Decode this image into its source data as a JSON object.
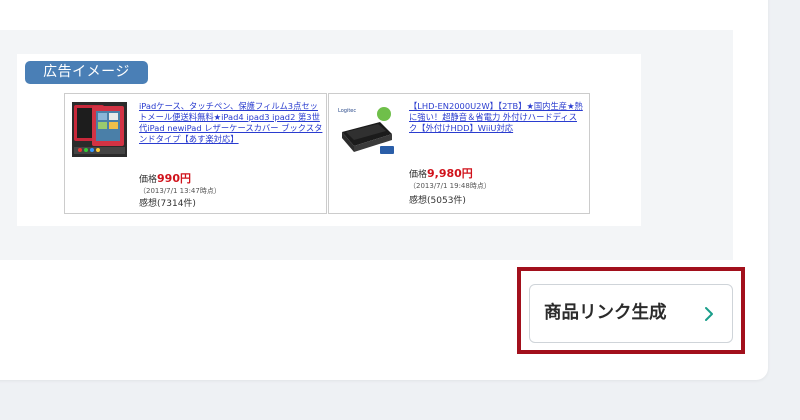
{
  "ad_preview": {
    "badge_label": "広告イメージ",
    "products": [
      {
        "title": "iPadケース、タッチペン、保護フィルム3点セットメール便送料無料★iPad4 ipad3 ipad2 第3世代iPad newiPad レザーケースカバー ブックスタンドタイプ【あす楽対応】",
        "price_label": "価格",
        "price": "990円",
        "date": "（2013/7/1 13:47時点）",
        "review": "感想(7314件)",
        "thumb_icon": "ipad-case-thumbnail"
      },
      {
        "title": "【LHD-EN2000U2W】【2TB】★国内生産★熱に強い！超静音＆省電力 外付けハードディスク【外付けHDD】WiiU対応",
        "price_label": "価格",
        "price": "9,980円",
        "date": "（2013/7/1 19:48時点）",
        "review": "感想(5053件)",
        "thumb_icon": "external-hdd-thumbnail"
      }
    ]
  },
  "actions": {
    "generate_link_label": "商品リンク生成",
    "chevron_icon": "chevron-right-icon"
  },
  "colors": {
    "badge": "#4a7fb6",
    "highlight": "#a2101c",
    "price": "#d0121b",
    "link": "#2a3ccf",
    "chevron": "#1a9e8a"
  }
}
